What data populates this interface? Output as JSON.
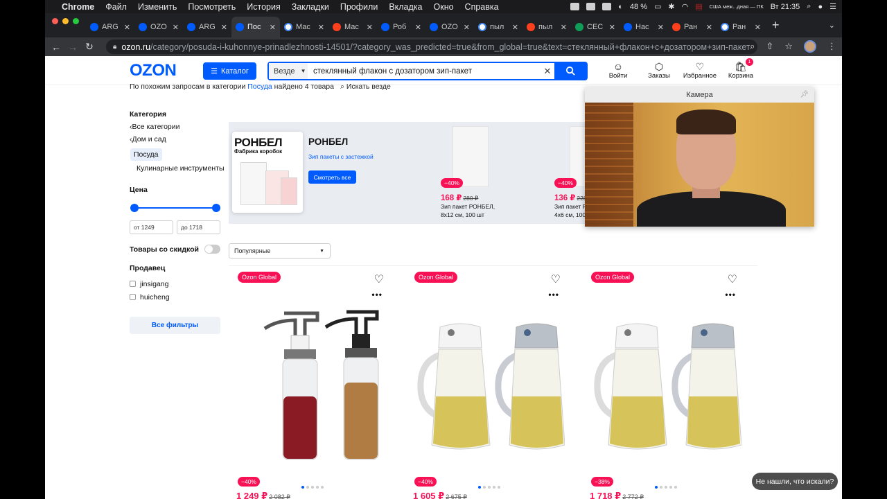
{
  "menubar": {
    "app": "Chrome",
    "items": [
      "Файл",
      "Изменить",
      "Посмотреть",
      "История",
      "Закладки",
      "Профили",
      "Вкладка",
      "Окно",
      "Справка"
    ],
    "battery": "48 %",
    "keyboard": "США меж...дная — ПК",
    "clock": "Вт 21:35"
  },
  "tabs": [
    {
      "title": "ARG",
      "icon": "ozon-icon",
      "color": "#005bff"
    },
    {
      "title": "OZO",
      "icon": "ozon-icon",
      "color": "#005bff"
    },
    {
      "title": "ARG",
      "icon": "ozon-icon",
      "color": "#005bff"
    },
    {
      "title": "Пос",
      "icon": "ozon-icon",
      "color": "#005bff",
      "active": true
    },
    {
      "title": "Мас",
      "icon": "google-icon",
      "color": "#ffffff"
    },
    {
      "title": "Мас",
      "icon": "yandex-icon",
      "color": "#fc3f1d"
    },
    {
      "title": "Роб",
      "icon": "ozon-icon",
      "color": "#005bff"
    },
    {
      "title": "OZO",
      "icon": "ozon-icon",
      "color": "#005bff"
    },
    {
      "title": "пыл",
      "icon": "google-icon",
      "color": "#ffffff"
    },
    {
      "title": "пыл",
      "icon": "yandex-icon",
      "color": "#fc3f1d"
    },
    {
      "title": "CEC",
      "icon": "sheets-icon",
      "color": "#0f9d58"
    },
    {
      "title": "Нас",
      "icon": "ozon-icon",
      "color": "#005bff"
    },
    {
      "title": "Ран",
      "icon": "yandex-icon",
      "color": "#fc3f1d"
    },
    {
      "title": "Ран",
      "icon": "google-icon",
      "color": "#ffffff"
    }
  ],
  "address": {
    "domain": "ozon.ru",
    "path": "/category/posuda-i-kuhonnye-prinadlezhnosti-14501/?category_was_predicted=true&from_global=true&text=стеклянный+флакон+с+дозатором+зип-пакет"
  },
  "header": {
    "logo": "OZON",
    "catalog": "Каталог",
    "scope": "Везде",
    "search_value": "стеклянный флакон с дозатором зип-пакет",
    "login": "Войти",
    "orders": "Заказы",
    "favorites": "Избранное",
    "cart": "Корзина",
    "cart_count": "1",
    "brand_color": "#005bff",
    "accent_color": "#f91155"
  },
  "similar": {
    "prefix": "По похожим запросам в категории",
    "category": "Посуда",
    "suffix": "найдено 4 товара",
    "search_all": "Искать везде"
  },
  "sidebar": {
    "category_title": "Категория",
    "all_categories": "Все категории",
    "home_garden": "Дом и сад",
    "dishes": "Посуда",
    "cooking_tools": "Кулинарные инструменты",
    "price_title": "Цена",
    "price_from": "от 1249",
    "price_to": "до 1718",
    "discount_label": "Товары со скидкой",
    "seller_title": "Продавец",
    "seller_1": "jinsigang",
    "seller_2": "huicheng",
    "all_filters": "Все фильтры"
  },
  "banner": {
    "brand": "РОНБЕЛ",
    "brand_caption": "Фабрика коробок",
    "subtitle": "Зип пакеты с застежкой",
    "button": "Смотреть все",
    "items": [
      {
        "discount": "−40%",
        "price": "168 ₽",
        "old_price": "280 ₽",
        "name_1": "Зип пакет РОНБЕЛ,",
        "name_2": "8x12 см, 100 шт"
      },
      {
        "discount": "−40%",
        "price": "136 ₽",
        "old_price": "228",
        "name_1": "Зип пакет Р",
        "name_2": "4x6 см, 100"
      }
    ]
  },
  "camera": {
    "title": "Камера"
  },
  "sort": {
    "value": "Популярные"
  },
  "products": [
    {
      "badge": "Ozon Global",
      "discount": "−40%",
      "price": "1 249 ₽",
      "old_price": "2 082 ₽"
    },
    {
      "badge": "Ozon Global",
      "discount": "−40%",
      "price": "1 605 ₽",
      "old_price": "2 675 ₽"
    },
    {
      "badge": "Ozon Global",
      "discount": "−38%",
      "price": "1 718 ₽",
      "old_price": "2 772 ₽"
    }
  ],
  "help_chip": "Не нашли, что искали?"
}
